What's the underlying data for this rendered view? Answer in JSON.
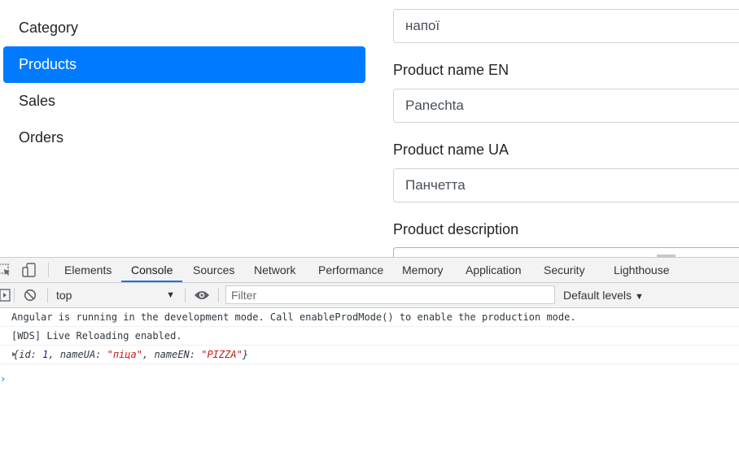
{
  "sidebar": {
    "items": [
      {
        "label": "Category"
      },
      {
        "label": "Products"
      },
      {
        "label": "Sales"
      },
      {
        "label": "Orders"
      }
    ]
  },
  "form": {
    "category_value": "напої",
    "name_en_label": "Product name EN",
    "name_en_value": "Panechta",
    "name_ua_label": "Product name UA",
    "name_ua_value": "Панчетта",
    "description_label": "Product description",
    "description_value": ""
  },
  "devtools": {
    "tabs": [
      {
        "label": "Elements"
      },
      {
        "label": "Console"
      },
      {
        "label": "Sources"
      },
      {
        "label": "Network"
      },
      {
        "label": "Performance"
      },
      {
        "label": "Memory"
      },
      {
        "label": "Application"
      },
      {
        "label": "Security"
      },
      {
        "label": "Lighthouse"
      }
    ],
    "active_tab": "Console",
    "context": "top",
    "filter_placeholder": "Filter",
    "levels": "Default levels",
    "messages": [
      "Angular is running in the development mode. Call enableProdMode() to enable the production mode.",
      "[WDS] Live Reloading enabled."
    ],
    "object_log": {
      "open": "{",
      "k1": "id: ",
      "v1": "1",
      "sep1": ", ",
      "k2": "nameUA: ",
      "v2": "\"піца\"",
      "sep2": ", ",
      "k3": "nameEN: ",
      "v3": "\"PIZZA\"",
      "close": "}"
    },
    "prompt": "›"
  },
  "colors": {
    "accent": "#007bff",
    "devtools_active": "#1a73e8",
    "string": "#c41a16",
    "number": "#1a1aa6"
  },
  "icons": [
    "inspect-element-icon",
    "device-toolbar-icon",
    "sidebar-toggle-icon",
    "clear-console-icon",
    "live-expression-eye-icon",
    "dropdown-arrow-icon",
    "expand-triangle-icon"
  ]
}
